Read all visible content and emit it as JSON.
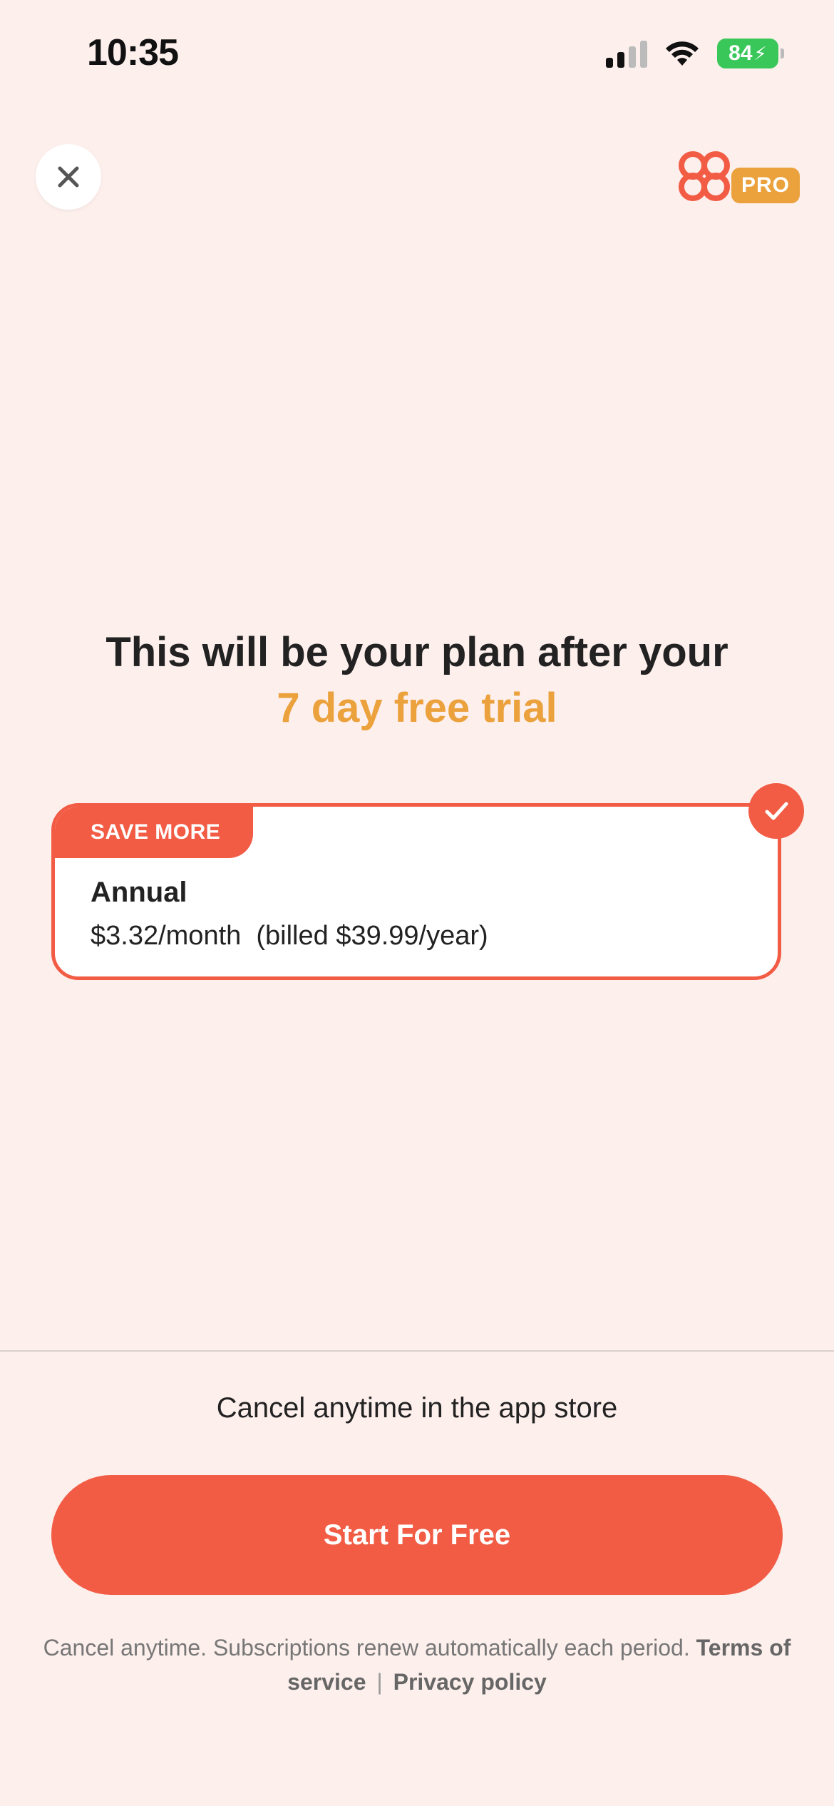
{
  "status_bar": {
    "time": "10:35",
    "battery": "84"
  },
  "header": {
    "close_icon": "close-icon",
    "logo_icon": "clover-icon",
    "badge": "PRO"
  },
  "headline": {
    "line1": "This will be your plan after your",
    "line2": "7 day free trial"
  },
  "plan": {
    "tag": "SAVE MORE",
    "name": "Annual",
    "price": "$3.32/month  (billed $39.99/year)",
    "selected": true
  },
  "footer": {
    "cancel_note": "Cancel anytime in the app store",
    "cta_label": "Start For Free",
    "legal_text": "Cancel anytime. Subscriptions renew automatically each period.",
    "terms_link": "Terms of service",
    "separator": "|",
    "privacy_link": "Privacy policy"
  },
  "colors": {
    "accent": "#F25C45",
    "highlight": "#EBA13C",
    "background": "#FDEFEC"
  }
}
